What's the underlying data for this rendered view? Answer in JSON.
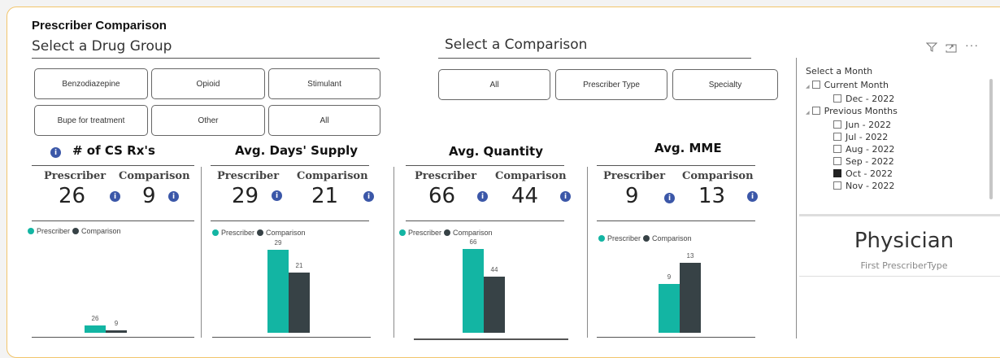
{
  "page_title": "Prescriber Comparison",
  "drug_group": {
    "header": "Select a Drug Group",
    "buttons": [
      "Benzodiazepine",
      "Opioid",
      "Stimulant",
      "Bupe for treatment",
      "Other",
      "All"
    ]
  },
  "comparison": {
    "header": "Select a Comparison",
    "buttons": [
      "All",
      "Prescriber Type",
      "Specialty"
    ]
  },
  "visual_icons": [
    "filter-icon",
    "focus-mode-icon",
    "more-options-icon"
  ],
  "kpis": [
    {
      "title": "# of CS Rx's",
      "prescriber_label": "Prescriber",
      "comparison_label": "Comparison",
      "prescriber": "26",
      "comparison": "9"
    },
    {
      "title": "Avg. Days' Supply",
      "prescriber_label": "Prescriber",
      "comparison_label": "Comparison",
      "prescriber": "29",
      "comparison": "21"
    },
    {
      "title": "Avg. Quantity",
      "prescriber_label": "Prescriber",
      "comparison_label": "Comparison",
      "prescriber": "66",
      "comparison": "44"
    },
    {
      "title": "Avg. MME",
      "prescriber_label": "Prescriber",
      "comparison_label": "Comparison",
      "prescriber": "9",
      "comparison": "13"
    }
  ],
  "legend": {
    "prescriber": "Prescriber",
    "comparison": "Comparison"
  },
  "colors": {
    "prescriber": "#13b5a3",
    "comparison": "#374246",
    "info": "#3b57a8",
    "frame": "#f2c56b"
  },
  "chart_data": [
    {
      "type": "bar",
      "categories": [
        "Prescriber",
        "Comparison"
      ],
      "values": [
        26,
        9
      ],
      "ylim": [
        0,
        300
      ]
    },
    {
      "type": "bar",
      "categories": [
        "Prescriber",
        "Comparison"
      ],
      "values": [
        29,
        21
      ],
      "ylim": [
        0,
        30
      ]
    },
    {
      "type": "bar",
      "categories": [
        "Prescriber",
        "Comparison"
      ],
      "values": [
        66,
        44
      ],
      "ylim": [
        0,
        68
      ]
    },
    {
      "type": "bar",
      "categories": [
        "Prescriber",
        "Comparison"
      ],
      "values": [
        9,
        13
      ],
      "ylim": [
        0,
        16
      ]
    }
  ],
  "month_slicer": {
    "title": "Select a Month",
    "groups": [
      {
        "label": "Current Month",
        "items": [
          {
            "label": "Dec - 2022",
            "checked": false
          }
        ]
      },
      {
        "label": "Previous Months",
        "items": [
          {
            "label": "Jun - 2022",
            "checked": false
          },
          {
            "label": "Jul - 2022",
            "checked": false
          },
          {
            "label": "Aug - 2022",
            "checked": false
          },
          {
            "label": "Sep - 2022",
            "checked": false
          },
          {
            "label": "Oct - 2022",
            "checked": true
          },
          {
            "label": "Nov - 2022",
            "checked": false
          }
        ]
      }
    ]
  },
  "prescriber_type": {
    "value": "Physician",
    "caption": "First PrescriberType"
  }
}
